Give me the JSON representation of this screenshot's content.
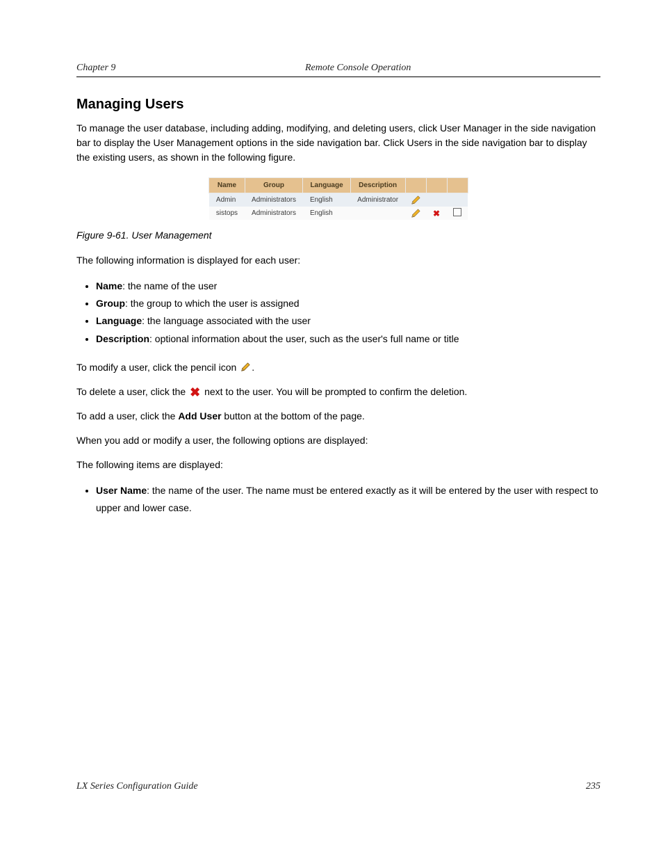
{
  "header": {
    "left": "Chapter 9",
    "center": "Remote Console Operation"
  },
  "section_title": "Managing Users",
  "intro_paragraph": "To manage the user database, including adding, modifying, and deleting users, click User Manager in the side navigation bar to display the User Management options in the side navigation bar. Click Users in the side navigation bar to display the existing users, as shown in the following figure.",
  "users_table": {
    "headers": [
      "Name",
      "Group",
      "Language",
      "Description"
    ],
    "rows": [
      {
        "name": "Admin",
        "group": "Administrators",
        "language": "English",
        "description": "Administrator",
        "edit": true,
        "del": false,
        "check": false
      },
      {
        "name": "sistops",
        "group": "Administrators",
        "language": "English",
        "description": "",
        "edit": true,
        "del": true,
        "check": true
      }
    ]
  },
  "figure_caption": "Figure 9-61. User Management",
  "fields_intro": "The following information is displayed for each user:",
  "fields": [
    {
      "name": "Name",
      "desc": ": the name of the user"
    },
    {
      "name": "Group",
      "desc": ": the group to which the user is assigned"
    },
    {
      "name": "Language",
      "desc": ": the language associated with the user"
    },
    {
      "name": "Description",
      "desc": ": optional information about the user, such as the user's full name or title"
    }
  ],
  "modify_text_before": "To modify a user, click the pencil icon",
  "modify_text_after": ".",
  "delete_text_before": "To delete a user, click the ",
  "delete_text_after": " next to the user. You will be prompted to confirm the deletion.",
  "add_text_before": "To add a user, click the ",
  "add_label": "Add User",
  "add_text_after": " button at the bottom of the page.",
  "add_modify_sentence": "When you add or modify a user, the following options are displayed:",
  "user_fields_intro": "The following items are displayed:",
  "user_name_field_label": "User Name",
  "user_name_field_desc": ": the name of the user. The name must be entered exactly as it will be entered by the user with respect to upper and lower case.",
  "footer": {
    "left": "LX Series Configuration Guide",
    "right": "235"
  }
}
